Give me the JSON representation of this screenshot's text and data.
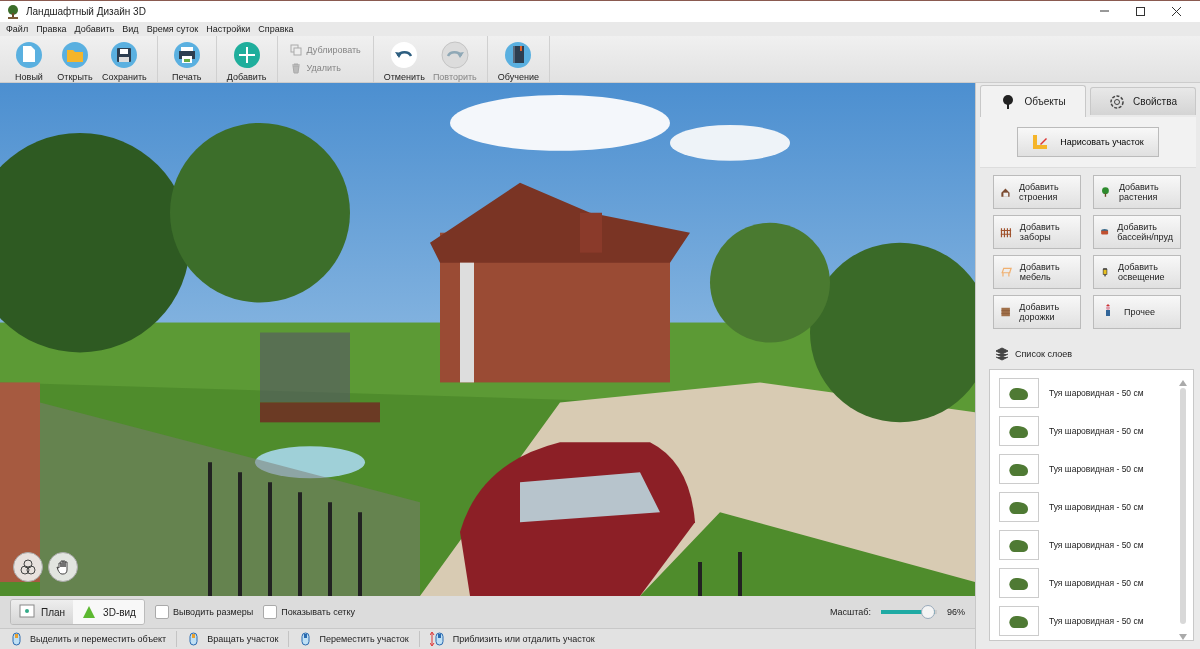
{
  "window": {
    "title": "Ландшафтный Дизайн 3D"
  },
  "menu": [
    "Файл",
    "Правка",
    "Добавить",
    "Вид",
    "Время суток",
    "Настройки",
    "Справка"
  ],
  "toolbar": {
    "groups": [
      {
        "items": [
          {
            "label": "Новый",
            "kind": "big",
            "disabled": false
          },
          {
            "label": "Открыть",
            "kind": "big",
            "disabled": false
          },
          {
            "label": "Сохранить",
            "kind": "big",
            "disabled": false
          }
        ]
      },
      {
        "items": [
          {
            "label": "Печать",
            "kind": "big",
            "disabled": false
          }
        ]
      },
      {
        "items": [
          {
            "label": "Добавить",
            "kind": "big",
            "disabled": false
          }
        ]
      },
      {
        "items": [
          {
            "label": "Дублировать",
            "kind": "small",
            "disabled": true
          },
          {
            "label": "Удалить",
            "kind": "small",
            "disabled": true
          }
        ]
      },
      {
        "items": [
          {
            "label": "Отменить",
            "kind": "big",
            "disabled": false
          },
          {
            "label": "Повторить",
            "kind": "big",
            "disabled": true
          }
        ]
      },
      {
        "items": [
          {
            "label": "Обучение",
            "kind": "big",
            "disabled": false
          }
        ]
      }
    ]
  },
  "view_bar": {
    "modes": [
      {
        "label": "План",
        "selected": false
      },
      {
        "label": "3D-вид",
        "selected": true
      }
    ],
    "options": [
      {
        "label": "Выводить размеры",
        "checked": false
      },
      {
        "label": "Показывать сетку",
        "checked": false
      }
    ],
    "zoom": {
      "label": "Масштаб:",
      "level": 0.96,
      "reading": "96%"
    }
  },
  "status_bar": [
    "Выделить и переместить объект",
    "Вращать участок",
    "Переместить участок",
    "Приблизить или отдалить участок"
  ],
  "side_panel": {
    "tabs": [
      {
        "label": "Объекты",
        "selected": true
      },
      {
        "label": "Свойства",
        "selected": false
      }
    ],
    "draw_button": "Нарисовать участок",
    "add_buttons": [
      "Добавить строения",
      "Добавить растения",
      "Добавить заборы",
      "Добавить бассейн/пруд",
      "Добавить мебель",
      "Добавить освещение",
      "Добавить дорожки",
      "Прочее"
    ],
    "layers_title": "Список слоев",
    "layers": [
      "Туя шаровидная - 50 см",
      "Туя шаровидная - 50 см",
      "Туя шаровидная - 50 см",
      "Туя шаровидная - 50 см",
      "Туя шаровидная - 50 см",
      "Туя шаровидная - 50 см",
      "Туя шаровидная - 50 см"
    ]
  }
}
